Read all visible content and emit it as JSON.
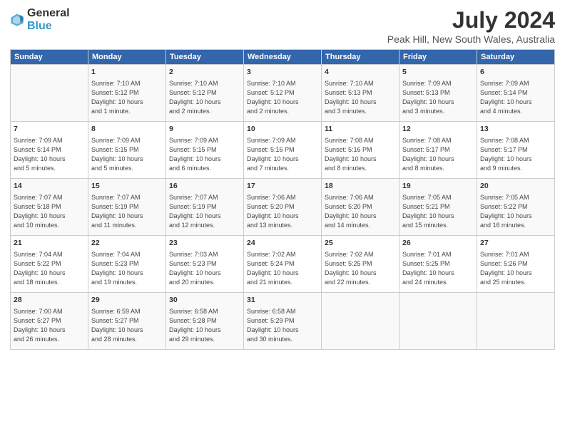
{
  "header": {
    "logo_general": "General",
    "logo_blue": "Blue",
    "title": "July 2024",
    "subtitle": "Peak Hill, New South Wales, Australia"
  },
  "columns": [
    "Sunday",
    "Monday",
    "Tuesday",
    "Wednesday",
    "Thursday",
    "Friday",
    "Saturday"
  ],
  "weeks": [
    [
      {
        "day": "",
        "content": ""
      },
      {
        "day": "1",
        "content": "Sunrise: 7:10 AM\nSunset: 5:12 PM\nDaylight: 10 hours\nand 1 minute."
      },
      {
        "day": "2",
        "content": "Sunrise: 7:10 AM\nSunset: 5:12 PM\nDaylight: 10 hours\nand 2 minutes."
      },
      {
        "day": "3",
        "content": "Sunrise: 7:10 AM\nSunset: 5:12 PM\nDaylight: 10 hours\nand 2 minutes."
      },
      {
        "day": "4",
        "content": "Sunrise: 7:10 AM\nSunset: 5:13 PM\nDaylight: 10 hours\nand 3 minutes."
      },
      {
        "day": "5",
        "content": "Sunrise: 7:09 AM\nSunset: 5:13 PM\nDaylight: 10 hours\nand 3 minutes."
      },
      {
        "day": "6",
        "content": "Sunrise: 7:09 AM\nSunset: 5:14 PM\nDaylight: 10 hours\nand 4 minutes."
      }
    ],
    [
      {
        "day": "7",
        "content": "Sunrise: 7:09 AM\nSunset: 5:14 PM\nDaylight: 10 hours\nand 5 minutes."
      },
      {
        "day": "8",
        "content": "Sunrise: 7:09 AM\nSunset: 5:15 PM\nDaylight: 10 hours\nand 5 minutes."
      },
      {
        "day": "9",
        "content": "Sunrise: 7:09 AM\nSunset: 5:15 PM\nDaylight: 10 hours\nand 6 minutes."
      },
      {
        "day": "10",
        "content": "Sunrise: 7:09 AM\nSunset: 5:16 PM\nDaylight: 10 hours\nand 7 minutes."
      },
      {
        "day": "11",
        "content": "Sunrise: 7:08 AM\nSunset: 5:16 PM\nDaylight: 10 hours\nand 8 minutes."
      },
      {
        "day": "12",
        "content": "Sunrise: 7:08 AM\nSunset: 5:17 PM\nDaylight: 10 hours\nand 8 minutes."
      },
      {
        "day": "13",
        "content": "Sunrise: 7:08 AM\nSunset: 5:17 PM\nDaylight: 10 hours\nand 9 minutes."
      }
    ],
    [
      {
        "day": "14",
        "content": "Sunrise: 7:07 AM\nSunset: 5:18 PM\nDaylight: 10 hours\nand 10 minutes."
      },
      {
        "day": "15",
        "content": "Sunrise: 7:07 AM\nSunset: 5:19 PM\nDaylight: 10 hours\nand 11 minutes."
      },
      {
        "day": "16",
        "content": "Sunrise: 7:07 AM\nSunset: 5:19 PM\nDaylight: 10 hours\nand 12 minutes."
      },
      {
        "day": "17",
        "content": "Sunrise: 7:06 AM\nSunset: 5:20 PM\nDaylight: 10 hours\nand 13 minutes."
      },
      {
        "day": "18",
        "content": "Sunrise: 7:06 AM\nSunset: 5:20 PM\nDaylight: 10 hours\nand 14 minutes."
      },
      {
        "day": "19",
        "content": "Sunrise: 7:05 AM\nSunset: 5:21 PM\nDaylight: 10 hours\nand 15 minutes."
      },
      {
        "day": "20",
        "content": "Sunrise: 7:05 AM\nSunset: 5:22 PM\nDaylight: 10 hours\nand 16 minutes."
      }
    ],
    [
      {
        "day": "21",
        "content": "Sunrise: 7:04 AM\nSunset: 5:22 PM\nDaylight: 10 hours\nand 18 minutes."
      },
      {
        "day": "22",
        "content": "Sunrise: 7:04 AM\nSunset: 5:23 PM\nDaylight: 10 hours\nand 19 minutes."
      },
      {
        "day": "23",
        "content": "Sunrise: 7:03 AM\nSunset: 5:23 PM\nDaylight: 10 hours\nand 20 minutes."
      },
      {
        "day": "24",
        "content": "Sunrise: 7:02 AM\nSunset: 5:24 PM\nDaylight: 10 hours\nand 21 minutes."
      },
      {
        "day": "25",
        "content": "Sunrise: 7:02 AM\nSunset: 5:25 PM\nDaylight: 10 hours\nand 22 minutes."
      },
      {
        "day": "26",
        "content": "Sunrise: 7:01 AM\nSunset: 5:25 PM\nDaylight: 10 hours\nand 24 minutes."
      },
      {
        "day": "27",
        "content": "Sunrise: 7:01 AM\nSunset: 5:26 PM\nDaylight: 10 hours\nand 25 minutes."
      }
    ],
    [
      {
        "day": "28",
        "content": "Sunrise: 7:00 AM\nSunset: 5:27 PM\nDaylight: 10 hours\nand 26 minutes."
      },
      {
        "day": "29",
        "content": "Sunrise: 6:59 AM\nSunset: 5:27 PM\nDaylight: 10 hours\nand 28 minutes."
      },
      {
        "day": "30",
        "content": "Sunrise: 6:58 AM\nSunset: 5:28 PM\nDaylight: 10 hours\nand 29 minutes."
      },
      {
        "day": "31",
        "content": "Sunrise: 6:58 AM\nSunset: 5:29 PM\nDaylight: 10 hours\nand 30 minutes."
      },
      {
        "day": "",
        "content": ""
      },
      {
        "day": "",
        "content": ""
      },
      {
        "day": "",
        "content": ""
      }
    ]
  ]
}
